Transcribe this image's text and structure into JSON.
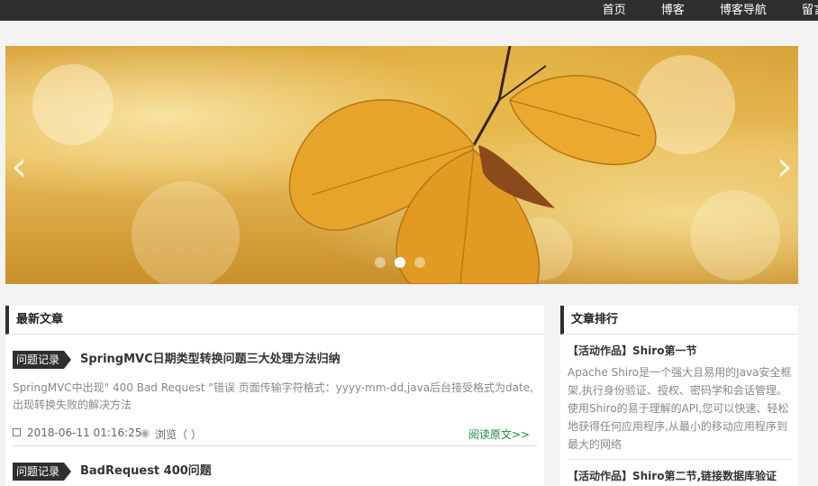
{
  "nav": {
    "items": [
      "首页",
      "博客",
      "博客导航",
      "留言"
    ]
  },
  "banner": {
    "prev_arrow": "‹",
    "next_arrow": "›",
    "slide_count": 3,
    "active_slide": 2
  },
  "latest": {
    "title": "最新文章",
    "articles": [
      {
        "tag": "问题记录",
        "title": "SpringMVC日期类型转换问题三大处理方法归纳",
        "summary": "SpringMVC中出现\" 400 Bad Request \"错误 页面传输字符格式：yyyy-mm-dd,java后台接受格式为date,出现转换失败的解决方法",
        "date": "2018-06-11 01:16:25",
        "views": "浏览（ ）",
        "read_more": "阅读原文>>"
      },
      {
        "tag": "问题记录",
        "title": "BadRequest 400问题"
      }
    ]
  },
  "ranking": {
    "title": "文章排行",
    "items": [
      {
        "title": "【活动作品】Shiro第一节",
        "desc": "Apache Shiro是一个强大且易用的Java安全框架,执行身份验证、授权、密码学和会话管理。使用Shiro的易于理解的API,您可以快速、轻松地获得任何应用程序,从最小的移动应用程序到最大的网络"
      },
      {
        "title": "【活动作品】Shiro第二节,链接数据库验证"
      }
    ]
  },
  "colors": {
    "topbar": "#2f2f2f",
    "read_more": "#1a8a3a"
  }
}
